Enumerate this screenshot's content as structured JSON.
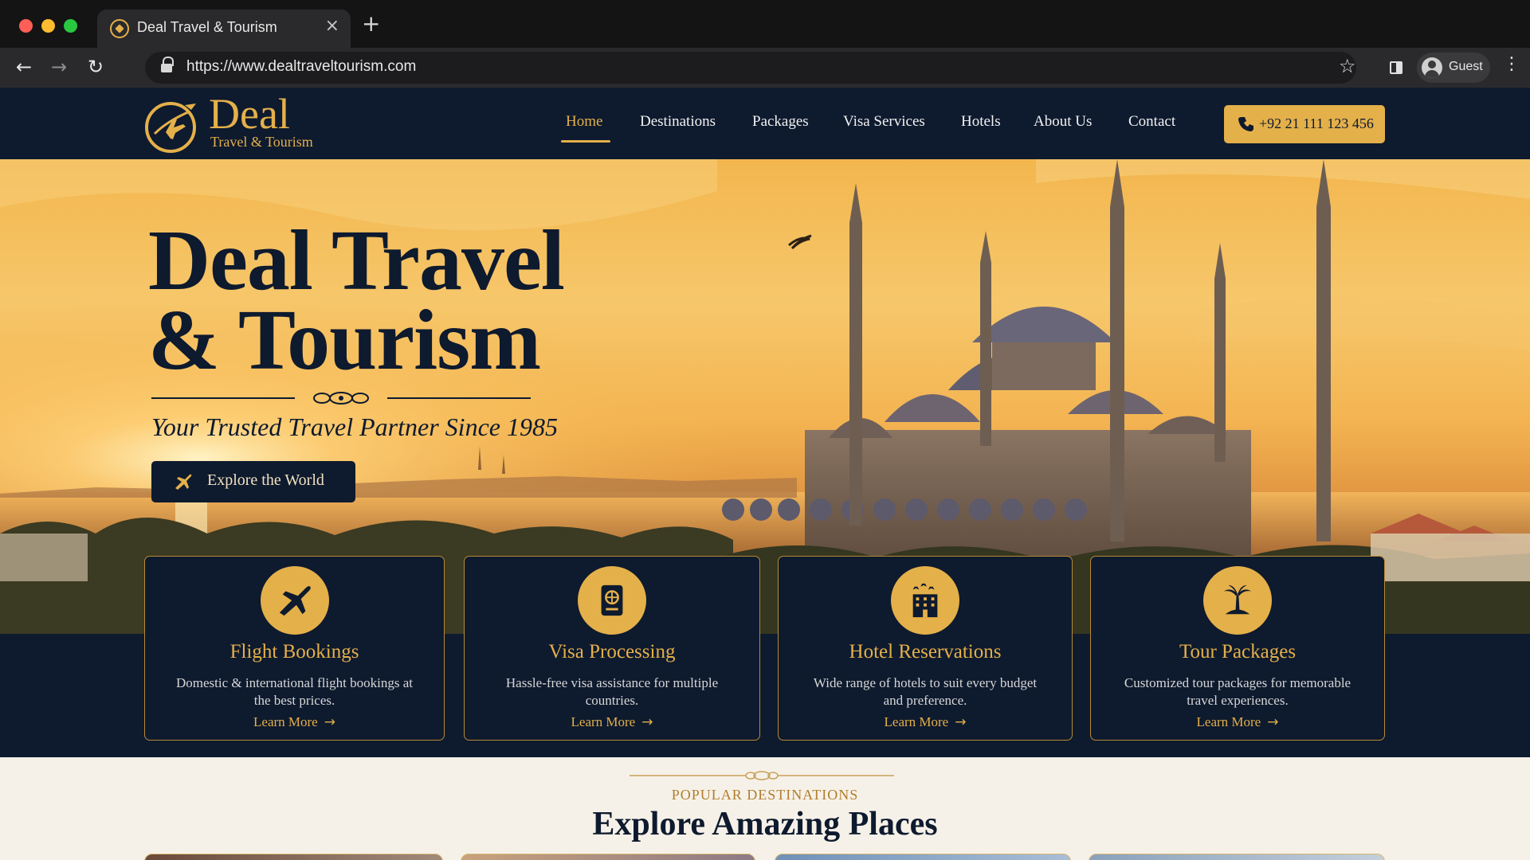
{
  "browser": {
    "tab_title": "Deal Travel & Tourism",
    "tab_close": "×",
    "new_tab": "+",
    "url": "https://www.dealtraveltourism.com",
    "profile_label": "Guest",
    "back": "←",
    "forward": "→",
    "reload": "↻",
    "bookmark": "☆",
    "menu": "⋮"
  },
  "header": {
    "logo_name": "Deal",
    "logo_sub": "Travel & Tourism",
    "nav": [
      {
        "label": "Home",
        "active": true
      },
      {
        "label": "Destinations"
      },
      {
        "label": "Packages"
      },
      {
        "label": "Visa Services"
      },
      {
        "label": "Hotels"
      },
      {
        "label": "About Us"
      },
      {
        "label": "Contact"
      }
    ],
    "phone": "+92 21 111 123 456"
  },
  "hero": {
    "title_line1": "Deal Travel",
    "title_line2": "& Tourism",
    "tagline": "Your Trusted Travel Partner Since 1985",
    "cta_label": "Explore the World"
  },
  "services": [
    {
      "icon": "airplane-icon",
      "title": "Flight Bookings",
      "desc": "Domestic & international flight bookings at the best prices.",
      "link": "Learn More"
    },
    {
      "icon": "passport-icon",
      "title": "Visa Processing",
      "desc": "Hassle-free visa assistance for multiple countries.",
      "link": "Learn More"
    },
    {
      "icon": "hotel-icon",
      "title": "Hotel Reservations",
      "desc": "Wide range of hotels to suit every budget and preference.",
      "link": "Learn More"
    },
    {
      "icon": "palm-island-icon",
      "title": "Tour Packages",
      "desc": "Customized tour packages for memorable travel experiences.",
      "link": "Learn More"
    }
  ],
  "destinations": {
    "eyebrow": "POPULAR DESTINATIONS",
    "title": "Explore Amazing Places"
  },
  "colors": {
    "navy": "#0e1a2e",
    "gold": "#e4b04a",
    "cream": "#f6f1e8"
  }
}
